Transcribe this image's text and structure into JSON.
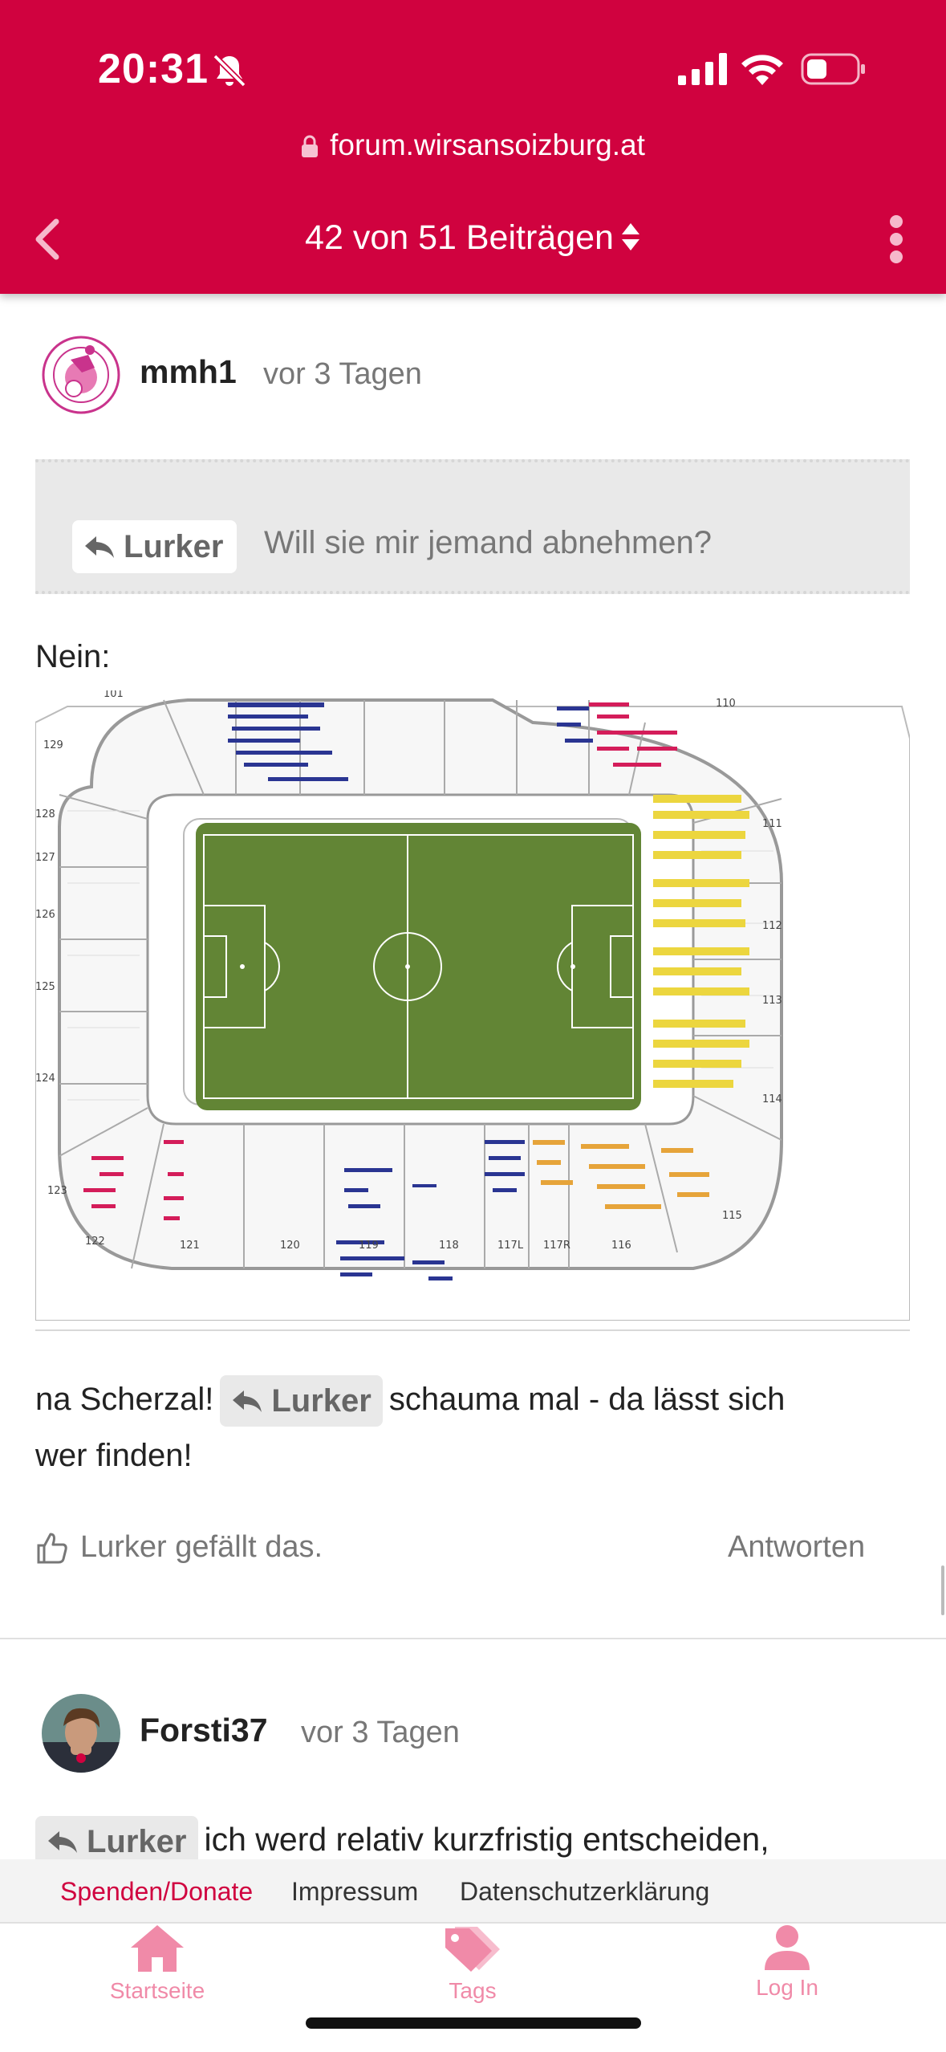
{
  "status_bar": {
    "time": "20:31"
  },
  "browser": {
    "url": "forum.wirsansoizburg.at"
  },
  "topic_nav": {
    "position": "42 von 51 Beiträgen"
  },
  "posts": [
    {
      "username": "mmh1",
      "time": "vor 3 Tagen",
      "quote": {
        "author": "Lurker",
        "text": "Will sie mir jemand abnehmen?"
      },
      "text_before_image": "Nein:",
      "reply_text_prefix": "na Scherzal!",
      "mention": "Lurker",
      "reply_text_suffix": "schauma mal - da lässt sich",
      "reply_text_line2": "wer finden!",
      "likes": "Lurker gefällt das.",
      "reply_button": "Antworten"
    },
    {
      "username": "Forsti37",
      "time": "vor 3 Tagen",
      "mention": "Lurker",
      "text": "ich werd relativ kurzfristig entscheiden,"
    }
  ],
  "stadium_map": {
    "section_labels": [
      "101",
      "129",
      "128",
      "127",
      "126",
      "125",
      "124",
      "123",
      "122",
      "121",
      "120",
      "119",
      "118",
      "117L",
      "117R",
      "116",
      "115",
      "114",
      "113",
      "112",
      "111",
      "110"
    ],
    "colors": {
      "pitch": "#628535",
      "blue_seats": "#2a3592",
      "red_seats": "#d41d5a",
      "yellow_seats": "#ecd63f",
      "orange_seats": "#e6a43a"
    }
  },
  "footer": {
    "links": [
      "Spenden/Donate",
      "Impressum",
      "Datenschutzerklärung"
    ]
  },
  "tabbar": {
    "items": [
      "Startseite",
      "Tags",
      "Log In"
    ]
  },
  "colors": {
    "brand": "#d0023f",
    "tab_label": "#f08aa8"
  }
}
